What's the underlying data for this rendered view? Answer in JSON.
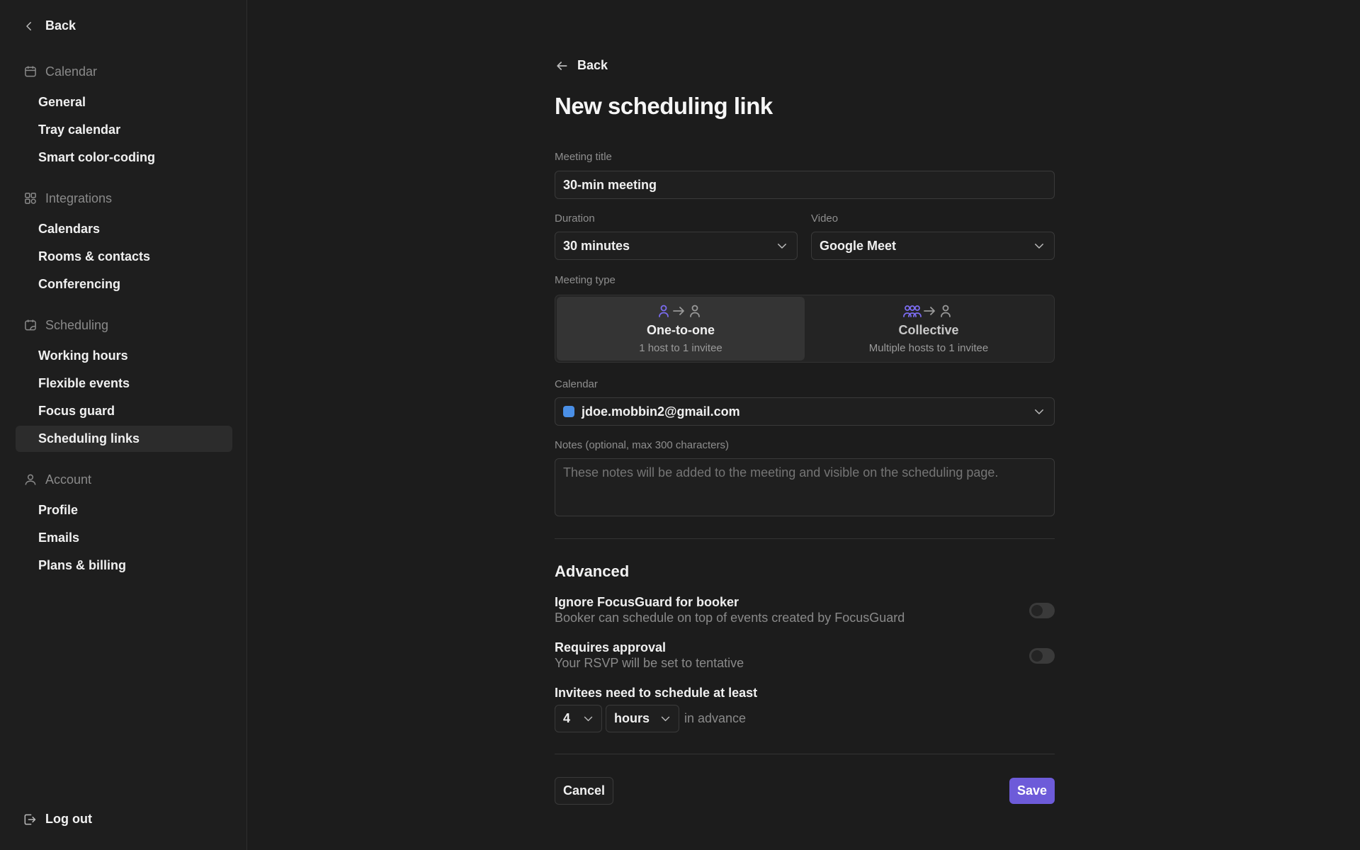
{
  "sidebar": {
    "back_label": "Back",
    "sections": [
      {
        "title": "Calendar",
        "icon": "calendar-icon",
        "items": [
          "General",
          "Tray calendar",
          "Smart color-coding"
        ]
      },
      {
        "title": "Integrations",
        "icon": "integrations-icon",
        "items": [
          "Calendars",
          "Rooms & contacts",
          "Conferencing"
        ]
      },
      {
        "title": "Scheduling",
        "icon": "scheduling-icon",
        "items": [
          "Working hours",
          "Flexible events",
          "Focus guard",
          "Scheduling links"
        ]
      },
      {
        "title": "Account",
        "icon": "user-icon",
        "items": [
          "Profile",
          "Emails",
          "Plans & billing"
        ]
      }
    ],
    "active_item": "Scheduling links",
    "logout_label": "Log out"
  },
  "main": {
    "back_label": "Back",
    "title": "New scheduling link",
    "meeting_title": {
      "label": "Meeting title",
      "value": "30-min meeting"
    },
    "duration": {
      "label": "Duration",
      "value": "30 minutes"
    },
    "video": {
      "label": "Video",
      "value": "Google Meet"
    },
    "meeting_type": {
      "label": "Meeting type",
      "options": [
        {
          "name": "One-to-one",
          "sub": "1 host to 1 invitee"
        },
        {
          "name": "Collective",
          "sub": "Multiple hosts to 1 invitee"
        }
      ],
      "selected": "One-to-one"
    },
    "calendar": {
      "label": "Calendar",
      "value": "jdoe.mobbin2@gmail.com",
      "color": "#4a8fe6"
    },
    "notes": {
      "label": "Notes (optional, max 300 characters)",
      "placeholder": "These notes will be added to the meeting and visible on the scheduling page."
    },
    "advanced": {
      "title": "Advanced",
      "ignore_focusguard": {
        "title": "Ignore FocusGuard for booker",
        "sub": "Booker can schedule on top of events created by FocusGuard"
      },
      "requires_approval": {
        "title": "Requires approval",
        "sub": "Your RSVP will be set to tentative"
      },
      "advance": {
        "title": "Invitees need to schedule at least",
        "amount": "4",
        "unit": "hours",
        "suffix": "in advance"
      }
    },
    "cancel_label": "Cancel",
    "save_label": "Save",
    "accent_color": "#6d5bd9"
  }
}
